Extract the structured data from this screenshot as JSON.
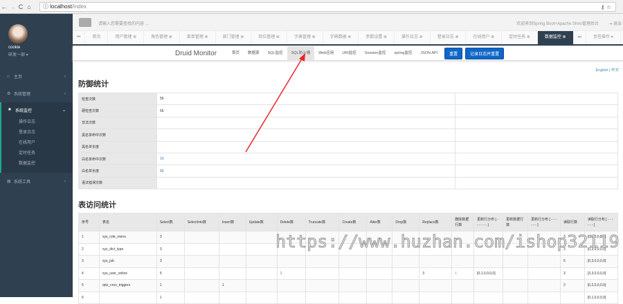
{
  "browser": {
    "url_host": "localhost",
    "url_path": "/index",
    "key_icon": "⚷",
    "star_icon": "☆"
  },
  "sidebar": {
    "user_name": "cookie",
    "user_dept": "研发一部 ▾",
    "items": [
      {
        "label": "主页",
        "icon": "home-icon"
      },
      {
        "label": "系统管理",
        "icon": "gear-icon"
      },
      {
        "label": "系统监控",
        "icon": "video-icon"
      },
      {
        "label": "系统工具",
        "icon": "tools-icon"
      }
    ],
    "sub_items": [
      "操作日志",
      "登录日志",
      "在线用户",
      "定时任务",
      "数据监控"
    ]
  },
  "topbar": {
    "search_placeholder": "请输入您需要查找的内容 …",
    "welcome": "欢迎来到Spring Boot+Apache Shiro管理后台",
    "logout": "⇥ 退出"
  },
  "tabs": {
    "items": [
      "首页",
      "用户管理 ⊗",
      "角色管理 ⊗",
      "菜单管理 ⊗",
      "部门管理 ⊗",
      "岗位管理 ⊗",
      "字典管理 ⊗",
      "字典数据 ⊗",
      "参数设置 ⊗",
      "操作日志 ⊗",
      "登录日志 ⊗",
      "在线用户 ⊗",
      "定时任务 ⊗",
      "数据监控 ⊗"
    ],
    "tab_ops": "页签操作 ▾",
    "refresh": "⟳ 刷"
  },
  "druid": {
    "brand": "Druid Monitor",
    "nav": [
      "首页",
      "数据源",
      "SQL监控",
      "SQL防火墙",
      "Web应用",
      "URI监控",
      "Session监控",
      "spring监控",
      "JSON API"
    ],
    "reset": "重置",
    "log_reset": "记录日志并重置",
    "lang": "English | 中文"
  },
  "defense": {
    "title": "防御统计",
    "rows": [
      {
        "label": "检查次数",
        "value": "56"
      },
      {
        "label": "硬检查次数",
        "value": "56"
      },
      {
        "label": "非法次数",
        "value": ""
      },
      {
        "label": "黑名单命中次数",
        "value": ""
      },
      {
        "label": "黑名单长度",
        "value": ""
      },
      {
        "label": "白名单命中次数",
        "value": "19"
      },
      {
        "label": "白名单长度",
        "value": "56"
      },
      {
        "label": "语法错误次数",
        "value": ""
      }
    ]
  },
  "tables": {
    "title": "表访问统计",
    "headers": [
      "序号",
      "表名",
      "Select数",
      "SelectInto数",
      "Insert数",
      "Update数",
      "Delete数",
      "Truncate数",
      "Create数",
      "Alter数",
      "Drop数",
      "Replace数",
      "删除数据行数",
      "更新行分布 [ - - - - - - ]",
      "更新数据行数",
      "更新行分布 [ - - - - - - ]",
      "读取行数",
      "读取行分布 [ - - - - - - ]"
    ],
    "rows": [
      [
        "1",
        "sys_role_menu",
        "3",
        "",
        "",
        "",
        "",
        "",
        "",
        "",
        "",
        "",
        "",
        "",
        "",
        "",
        "3",
        "[0,3,0,0,0,0]"
      ],
      [
        "2",
        "sys_dict_type",
        "3",
        "",
        "",
        "",
        "",
        "",
        "",
        "",
        "",
        "",
        "",
        "",
        "",
        "",
        "3",
        "[0,3,0,0,0,0]"
      ],
      [
        "3",
        "sys_job",
        "3",
        "",
        "",
        "",
        "",
        "",
        "",
        "",
        "",
        "",
        "",
        "",
        "",
        "",
        "5",
        "[0,3,0,0,0,0]"
      ],
      [
        "4",
        "sys_user_online",
        "5",
        "",
        "",
        "",
        "1",
        "",
        "",
        "",
        "",
        "3",
        "1",
        "[0,1,0,0,0,0]",
        "",
        "",
        "3",
        "[3,3,0,0,0,0]"
      ],
      [
        "5",
        "qrtz_cron_triggers",
        "1",
        "",
        "1",
        "",
        "",
        "",
        "",
        "",
        "",
        "",
        "",
        "",
        "",
        "",
        "2",
        "[0,2,0,0,0,0]"
      ],
      [
        "6",
        "",
        "1",
        "",
        "",
        "",
        "",
        "",
        "",
        "",
        "",
        "",
        "",
        "",
        "",
        "",
        "",
        "[0,1,0,0,0,0]"
      ]
    ]
  },
  "watermark": "https://www.huzhan.com/ishop32119"
}
